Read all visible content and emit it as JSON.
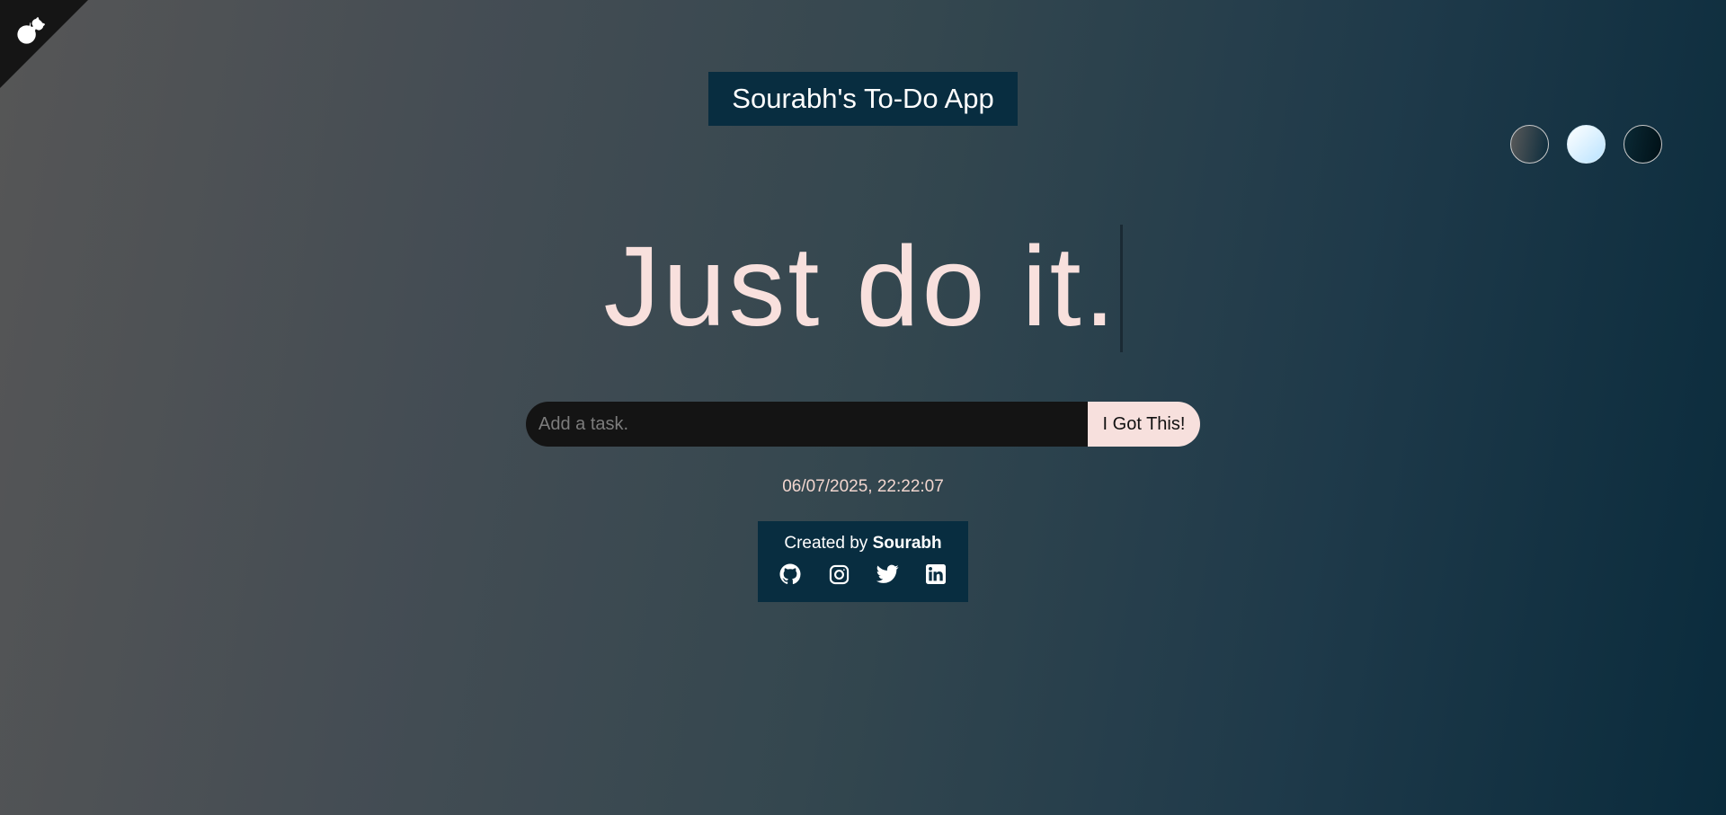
{
  "app": {
    "title": "Sourabh's To-Do App",
    "headline": "Just do it."
  },
  "corner_link": {
    "icon": "github-octocat-icon"
  },
  "themes": [
    {
      "name": "standard",
      "colors": [
        "#5a5a5a",
        "#0a2b3c"
      ]
    },
    {
      "name": "light",
      "colors": [
        "#ffffff",
        "#b9e3ff"
      ]
    },
    {
      "name": "darker",
      "colors": [
        "#0b2a36",
        "#001016"
      ]
    }
  ],
  "task_form": {
    "placeholder": "Add a task.",
    "value": "",
    "submit_label": "I Got This!"
  },
  "datetime": "06/07/2025, 22:22:07",
  "credit": {
    "prefix": "Created by",
    "author": "Sourabh",
    "socials": [
      {
        "icon": "github-icon"
      },
      {
        "icon": "instagram-icon"
      },
      {
        "icon": "twitter-icon"
      },
      {
        "icon": "linkedin-icon"
      }
    ]
  },
  "colors": {
    "accent": "#f8e0dd",
    "panel": "#082d40",
    "input_bg": "#141414"
  }
}
